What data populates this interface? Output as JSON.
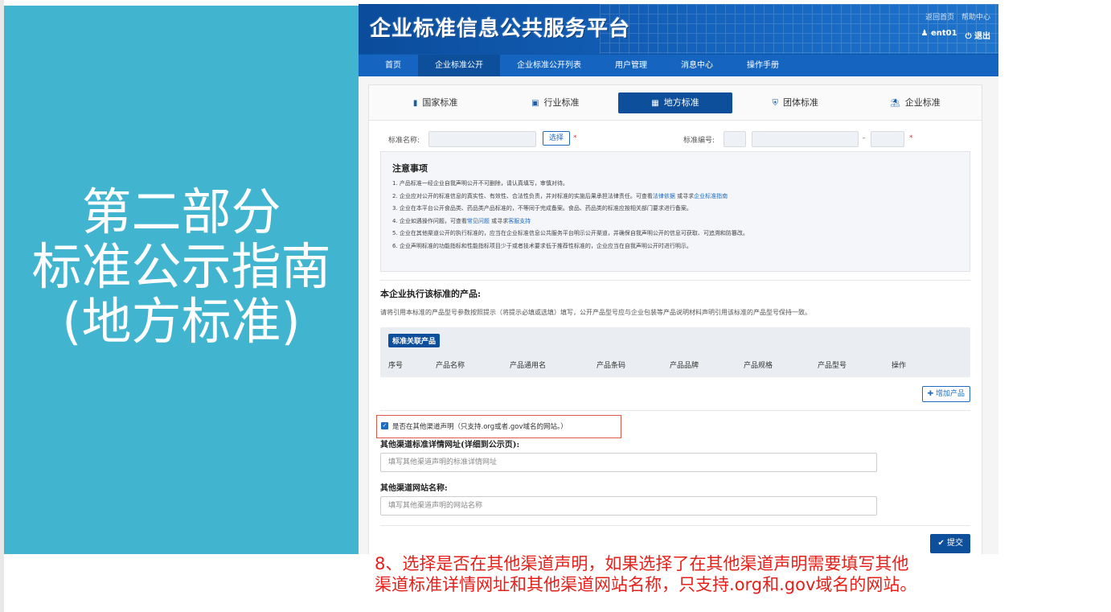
{
  "left_panel": {
    "line1": "第二部分",
    "line2": "标准公示指南",
    "line3": "(地方标准)"
  },
  "header": {
    "logo": "企业标准信息公共服务平台",
    "links": [
      "返回首页",
      "帮助中心"
    ],
    "user": "ent01",
    "logout": "退出"
  },
  "nav": {
    "items": [
      "首页",
      "企业标准公开",
      "企业标准公开列表",
      "用户管理",
      "消息中心",
      "操作手册"
    ],
    "active": "企业标准公开"
  },
  "tabs": [
    {
      "label": "国家标准",
      "icon": "book-icon"
    },
    {
      "label": "行业标准",
      "icon": "briefcase-icon"
    },
    {
      "label": "地方标准",
      "icon": "document-icon"
    },
    {
      "label": "团体标准",
      "icon": "shield-icon"
    },
    {
      "label": "企业标准",
      "icon": "bank-icon"
    }
  ],
  "form": {
    "std_name_label": "标准名称:",
    "select_button": "选择",
    "std_no_label": "标准编号:",
    "required": "*",
    "dash": "-"
  },
  "notice": {
    "title": "注意事项",
    "item1": "1. 产品标准一经企业自我声明公开不可删除，请认真填写，审慎对待。",
    "item2_pre": "2. 企业应对公开的标准信息的真实性、有效性、合法性负责，并对标准的实施后果承担法律责任。可查看",
    "item2_link1": "法律依据",
    "item2_mid": " 或寻求",
    "item2_link2": "企业标准指南",
    "item3": "3. 企业在本平台公开食品类、药品类产品标准的，不等同于完成备案。食品、药品类的标准应按相关部门要求进行备案。",
    "item4_pre": "4. 企业如遇操作问题，可查看",
    "item4_link1": "常见问题",
    "item4_mid": " 或寻求",
    "item4_link2": "客服支持",
    "item5": "5. 企业在其他渠道公开的执行标准的，应当在企业标准信息公共服务平台明示公开渠道，并确保自我声明公开的信息可获取、可追溯和防篡改。",
    "item6": "6. 企业声明标准的功能指标和性能指标项目少于或者技术要求低于推荐性标准的，企业应当在自我声明公开时进行明示。"
  },
  "products": {
    "title": "本企业执行该标准的产品:",
    "desc": "请将引用本标准的产品型号参数按照提示（将提示必填或选填）填写，公开产品型号应与企业包装等产品说明材料声明引用该标准的产品型号保持一致。",
    "badge": "标准关联产品",
    "columns": [
      "序号",
      "产品名称",
      "产品通用名",
      "产品条码",
      "产品品牌",
      "产品规格",
      "产品型号",
      "操作"
    ],
    "add_button": "增加产品"
  },
  "other_channel": {
    "checkbox_label": "是否在其他渠道声明（只支持.org或者.gov域名的网站。）",
    "checked": true,
    "url_label": "其他渠道标准详情网址(详细到公示页):",
    "url_placeholder": "填写其他渠道声明的标准详情网址",
    "site_label": "其他渠道网站名称:",
    "site_placeholder": "填写其他渠道声明的网站名称"
  },
  "submit_button": "提交",
  "caption": {
    "line1": "8、选择是否在其他渠道声明，如果选择了在其他渠道声明需要填写其他",
    "line2": "渠道标准详情网址和其他渠道网站名称，只支持.org和.gov域名的网站。"
  },
  "colors": {
    "panel": "#41b5d0",
    "primary": "#0d4f9a",
    "caption": "#e5201a"
  }
}
